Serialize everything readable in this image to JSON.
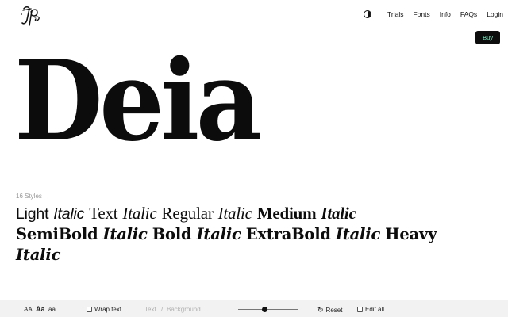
{
  "header": {
    "logo_name": "type-foundry-logo",
    "nav": [
      {
        "label": "Trials"
      },
      {
        "label": "Fonts"
      },
      {
        "label": "Info"
      },
      {
        "label": "FAQs"
      },
      {
        "label": "Login"
      }
    ],
    "buy_label": "Buy",
    "buy_text_color": "#7ff0c8"
  },
  "hero": {
    "title": "Deia"
  },
  "styles": {
    "count_label": "16 Styles",
    "items": [
      {
        "text": "Light",
        "weight": "light",
        "italic": false
      },
      {
        "text": "Italic",
        "weight": "light",
        "italic": true
      },
      {
        "text": "Text",
        "weight": "text",
        "italic": false
      },
      {
        "text": "Italic",
        "weight": "text",
        "italic": true
      },
      {
        "text": "Regular",
        "weight": "regular",
        "italic": false
      },
      {
        "text": "Italic",
        "weight": "regular",
        "italic": true
      },
      {
        "text": "Medium",
        "weight": "medium",
        "italic": false
      },
      {
        "text": "Italic",
        "weight": "medium",
        "italic": true
      },
      {
        "text": "SemiBold",
        "weight": "semibold",
        "italic": false
      },
      {
        "text": "Italic",
        "weight": "semibold",
        "italic": true
      },
      {
        "text": "Bold",
        "weight": "bold",
        "italic": false
      },
      {
        "text": "Italic",
        "weight": "bold",
        "italic": true
      },
      {
        "text": "ExtraBold",
        "weight": "extrabold",
        "italic": false
      },
      {
        "text": "Italic",
        "weight": "extrabold",
        "italic": true
      },
      {
        "text": "Heavy",
        "weight": "heavy",
        "italic": false
      },
      {
        "text": "Italic",
        "weight": "heavy",
        "italic": true
      }
    ]
  },
  "toolbar": {
    "size_options": [
      "AA",
      "Aa",
      "aa"
    ],
    "wrap_label": "Wrap text",
    "text_label": "Text",
    "separator": "/",
    "background_label": "Background",
    "slider_value": 0.45,
    "reset_label": "Reset",
    "edit_all_label": "Edit all"
  }
}
